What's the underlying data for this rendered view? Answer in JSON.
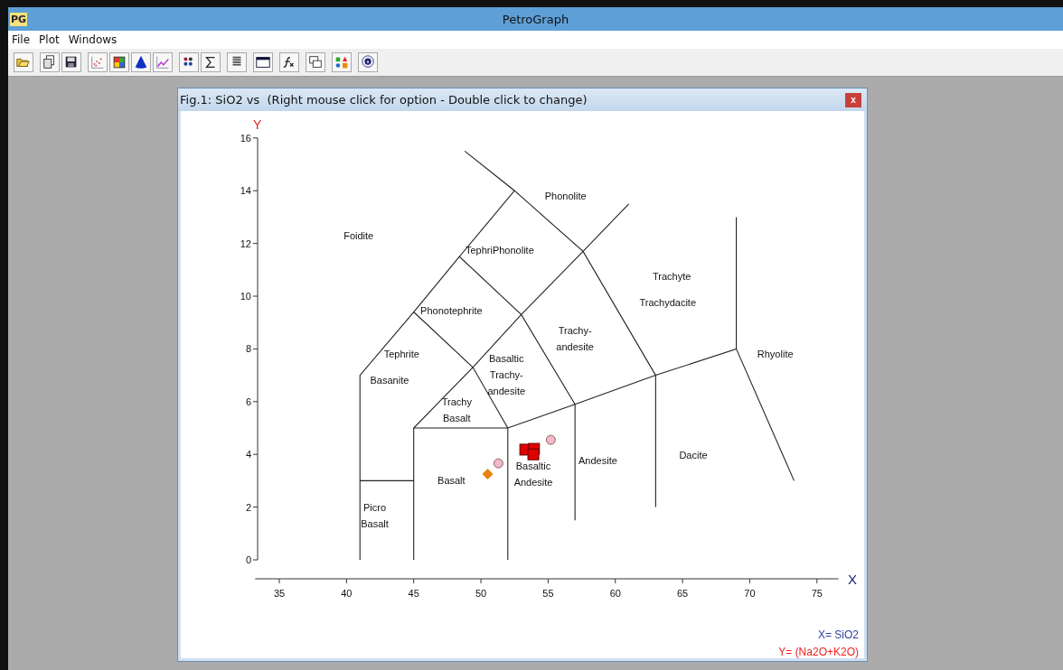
{
  "window": {
    "title": "PetroGraph",
    "app_badge": "PG"
  },
  "menu": [
    "File",
    "Plot",
    "Windows"
  ],
  "child_window": {
    "title": "Fig.1: SiO2 vs  (Right mouse click for option - Double click to change)",
    "close": "x",
    "chart": {
      "x_axis_mark": "X",
      "y_axis_mark": "Y",
      "axis_captions": [
        "X= SiO2",
        "Y= (Na2O+K2O)"
      ],
      "chart_data": {
        "type": "scatter",
        "xlim": [
          33.2,
          76.6
        ],
        "ylim": [
          0,
          16
        ],
        "xticks": [
          {
            "value": 35,
            "label": "35"
          },
          {
            "value": 40,
            "label": "40"
          },
          {
            "value": 45,
            "label": "45"
          },
          {
            "value": 50,
            "label": "50"
          },
          {
            "value": 55,
            "label": "55"
          },
          {
            "value": 60,
            "label": "60"
          },
          {
            "value": 65,
            "label": "65"
          },
          {
            "value": 70,
            "label": "70"
          },
          {
            "value": 75,
            "label": "75"
          }
        ],
        "yticks": [
          {
            "value": 0,
            "label": "0"
          },
          {
            "value": 2,
            "label": "2"
          },
          {
            "value": 4,
            "label": "4"
          },
          {
            "value": 6,
            "label": "6"
          },
          {
            "value": 8,
            "label": "8"
          },
          {
            "value": 10,
            "label": "10"
          },
          {
            "value": 12,
            "label": "12"
          },
          {
            "value": 14,
            "label": "14"
          },
          {
            "value": 16,
            "label": "16"
          }
        ],
        "series": [
          {
            "marker": "square",
            "color": "#e00000",
            "x": [
              53.3,
              53.95,
              53.9
            ],
            "values": [
              4.18,
              4.21,
              4.0
            ]
          },
          {
            "marker": "circle",
            "color": "#f4b8c8",
            "x": [
              51.3,
              55.2
            ],
            "values": [
              3.66,
              4.55
            ]
          },
          {
            "marker": "diamond",
            "color": "#e8820e",
            "x": [
              50.5
            ],
            "values": [
              3.25
            ]
          },
          {
            "type": "line",
            "color": "#222222",
            "x": [
              41,
              45,
              null,
              41,
              41,
              45,
              48.4,
              52.5,
              48.8,
              null,
              45,
              45,
              49.4,
              53,
              57.6,
              61,
              null,
              45,
              52,
              57,
              63,
              69,
              73.3,
              null,
              52,
              52,
              null,
              57,
              57,
              null,
              63,
              63,
              null,
              69,
              69,
              null,
              52,
              49.4,
              45,
              null,
              57,
              53,
              48.4,
              null,
              63,
              57.6,
              52.5
            ],
            "values": [
              3,
              3,
              null,
              0,
              7,
              9.4,
              11.5,
              14,
              15.5,
              null,
              0,
              5,
              7.3,
              9.3,
              11.7,
              13.5,
              null,
              5,
              5,
              5.9,
              7,
              8,
              3,
              null,
              0,
              5,
              null,
              1.5,
              5.9,
              null,
              2,
              7,
              null,
              8,
              13,
              null,
              5,
              7.3,
              9.4,
              null,
              5.9,
              9.3,
              11.5,
              null,
              7,
              11.7,
              14
            ]
          }
        ],
        "annotations": [
          "Phonolite",
          "Foidite",
          "TephriPhonolite",
          "Trachyte",
          "Trachydacite",
          "Phonotephrite",
          "Trachy- andesite",
          "Rhyolite",
          "Tephrite",
          "Basaltic Trachy- andesite",
          "Basanite",
          "Trachy Basalt",
          "Dacite",
          "Andesite",
          "Basaltic Andesite",
          "Basalt",
          "Picro Basalt"
        ]
      }
    }
  }
}
